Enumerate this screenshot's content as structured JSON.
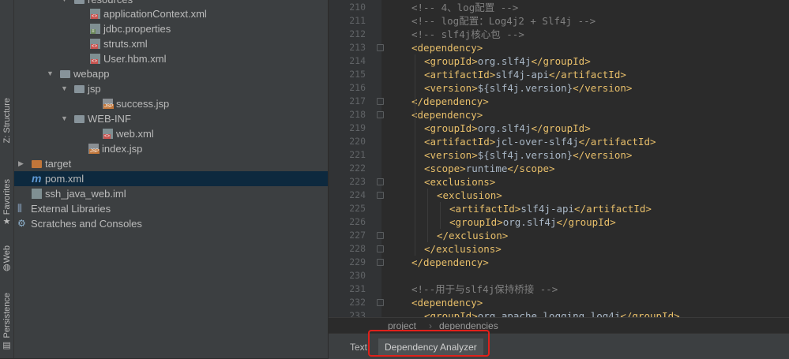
{
  "left_strip": {
    "tabs": [
      {
        "label": "Z: Structure",
        "icon": "structure-icon"
      },
      {
        "label": "Favorites",
        "icon": "star-icon"
      },
      {
        "label": "Web",
        "icon": "web-icon"
      },
      {
        "label": "Persistence",
        "icon": "persistence-icon"
      }
    ]
  },
  "tree": {
    "items": [
      {
        "label": "resources",
        "icon": "folder-icon"
      },
      {
        "label": "applicationContext.xml",
        "icon": "xml-file-icon"
      },
      {
        "label": "jdbc.properties",
        "icon": "properties-file-icon"
      },
      {
        "label": "struts.xml",
        "icon": "xml-file-icon"
      },
      {
        "label": "User.hbm.xml",
        "icon": "xml-file-icon"
      },
      {
        "label": "webapp",
        "icon": "folder-icon"
      },
      {
        "label": "jsp",
        "icon": "folder-icon"
      },
      {
        "label": "success.jsp",
        "icon": "jsp-file-icon"
      },
      {
        "label": "WEB-INF",
        "icon": "folder-icon"
      },
      {
        "label": "web.xml",
        "icon": "xml-file-icon"
      },
      {
        "label": "index.jsp",
        "icon": "jsp-file-icon"
      },
      {
        "label": "target",
        "icon": "excluded-folder-icon"
      },
      {
        "label": "pom.xml",
        "icon": "maven-icon"
      },
      {
        "label": "ssh_java_web.iml",
        "icon": "iml-file-icon"
      },
      {
        "label": "External Libraries",
        "icon": "libraries-icon"
      },
      {
        "label": "Scratches and Consoles",
        "icon": "scratches-icon"
      }
    ]
  },
  "editor": {
    "lines": [
      {
        "n": "210",
        "parts": [
          [
            "c",
            "<!-- 4、log配置 -->"
          ]
        ]
      },
      {
        "n": "211",
        "parts": [
          [
            "c",
            "<!-- log配置：Log4j2 + Slf4j -->"
          ]
        ]
      },
      {
        "n": "212",
        "parts": [
          [
            "c",
            "<!-- slf4j核心包 -->"
          ]
        ]
      },
      {
        "n": "213",
        "parts": [
          [
            "t",
            "<dependency>"
          ]
        ]
      },
      {
        "n": "214",
        "parts": [
          [
            "t",
            "<groupId>"
          ],
          [
            "x",
            "org.slf4j"
          ],
          [
            "t",
            "</groupId>"
          ]
        ]
      },
      {
        "n": "215",
        "parts": [
          [
            "t",
            "<artifactId>"
          ],
          [
            "x",
            "slf4j-api"
          ],
          [
            "t",
            "</artifactId>"
          ]
        ]
      },
      {
        "n": "216",
        "parts": [
          [
            "t",
            "<version>"
          ],
          [
            "x",
            "${slf4j.version}"
          ],
          [
            "t",
            "</version>"
          ]
        ]
      },
      {
        "n": "217",
        "parts": [
          [
            "t",
            "</dependency>"
          ]
        ]
      },
      {
        "n": "218",
        "parts": [
          [
            "t",
            "<dependency>"
          ]
        ]
      },
      {
        "n": "219",
        "parts": [
          [
            "t",
            "<groupId>"
          ],
          [
            "x",
            "org.slf4j"
          ],
          [
            "t",
            "</groupId>"
          ]
        ]
      },
      {
        "n": "220",
        "parts": [
          [
            "t",
            "<artifactId>"
          ],
          [
            "x",
            "jcl-over-slf4j"
          ],
          [
            "t",
            "</artifactId>"
          ]
        ]
      },
      {
        "n": "221",
        "parts": [
          [
            "t",
            "<version>"
          ],
          [
            "x",
            "${slf4j.version}"
          ],
          [
            "t",
            "</version>"
          ]
        ]
      },
      {
        "n": "222",
        "parts": [
          [
            "t",
            "<scope>"
          ],
          [
            "x",
            "runtime"
          ],
          [
            "t",
            "</scope>"
          ]
        ]
      },
      {
        "n": "223",
        "parts": [
          [
            "t",
            "<exclusions>"
          ]
        ]
      },
      {
        "n": "224",
        "parts": [
          [
            "t",
            "<exclusion>"
          ]
        ]
      },
      {
        "n": "225",
        "parts": [
          [
            "t",
            "<artifactId>"
          ],
          [
            "x",
            "slf4j-api"
          ],
          [
            "t",
            "</artifactId>"
          ]
        ]
      },
      {
        "n": "226",
        "parts": [
          [
            "t",
            "<groupId>"
          ],
          [
            "x",
            "org.slf4j"
          ],
          [
            "t",
            "</groupId>"
          ]
        ]
      },
      {
        "n": "227",
        "parts": [
          [
            "t",
            "</exclusion>"
          ]
        ]
      },
      {
        "n": "228",
        "parts": [
          [
            "t",
            "</exclusions>"
          ]
        ]
      },
      {
        "n": "229",
        "parts": [
          [
            "t",
            "</dependency>"
          ]
        ]
      },
      {
        "n": "230",
        "parts": []
      },
      {
        "n": "231",
        "parts": [
          [
            "c",
            "<!--用于与slf4j保持桥接 -->"
          ]
        ]
      },
      {
        "n": "232",
        "parts": [
          [
            "t",
            "<dependency>"
          ]
        ]
      },
      {
        "n": "233",
        "parts": [
          [
            "t",
            "<groupId>"
          ],
          [
            "x",
            "org.apache.logging.log4j"
          ],
          [
            "t",
            "</groupId>"
          ]
        ]
      }
    ]
  },
  "breadcrumb": {
    "items": [
      "project",
      "dependencies"
    ],
    "separator": "›"
  },
  "bottom_tabs": {
    "text": "Text",
    "dependency_analyzer": "Dependency Analyzer"
  },
  "colors": {
    "comment": "#808080",
    "tag": "#e8bf6a",
    "text": "#a9b7c6",
    "highlight": "#e0201a",
    "selection": "#0d293e"
  }
}
